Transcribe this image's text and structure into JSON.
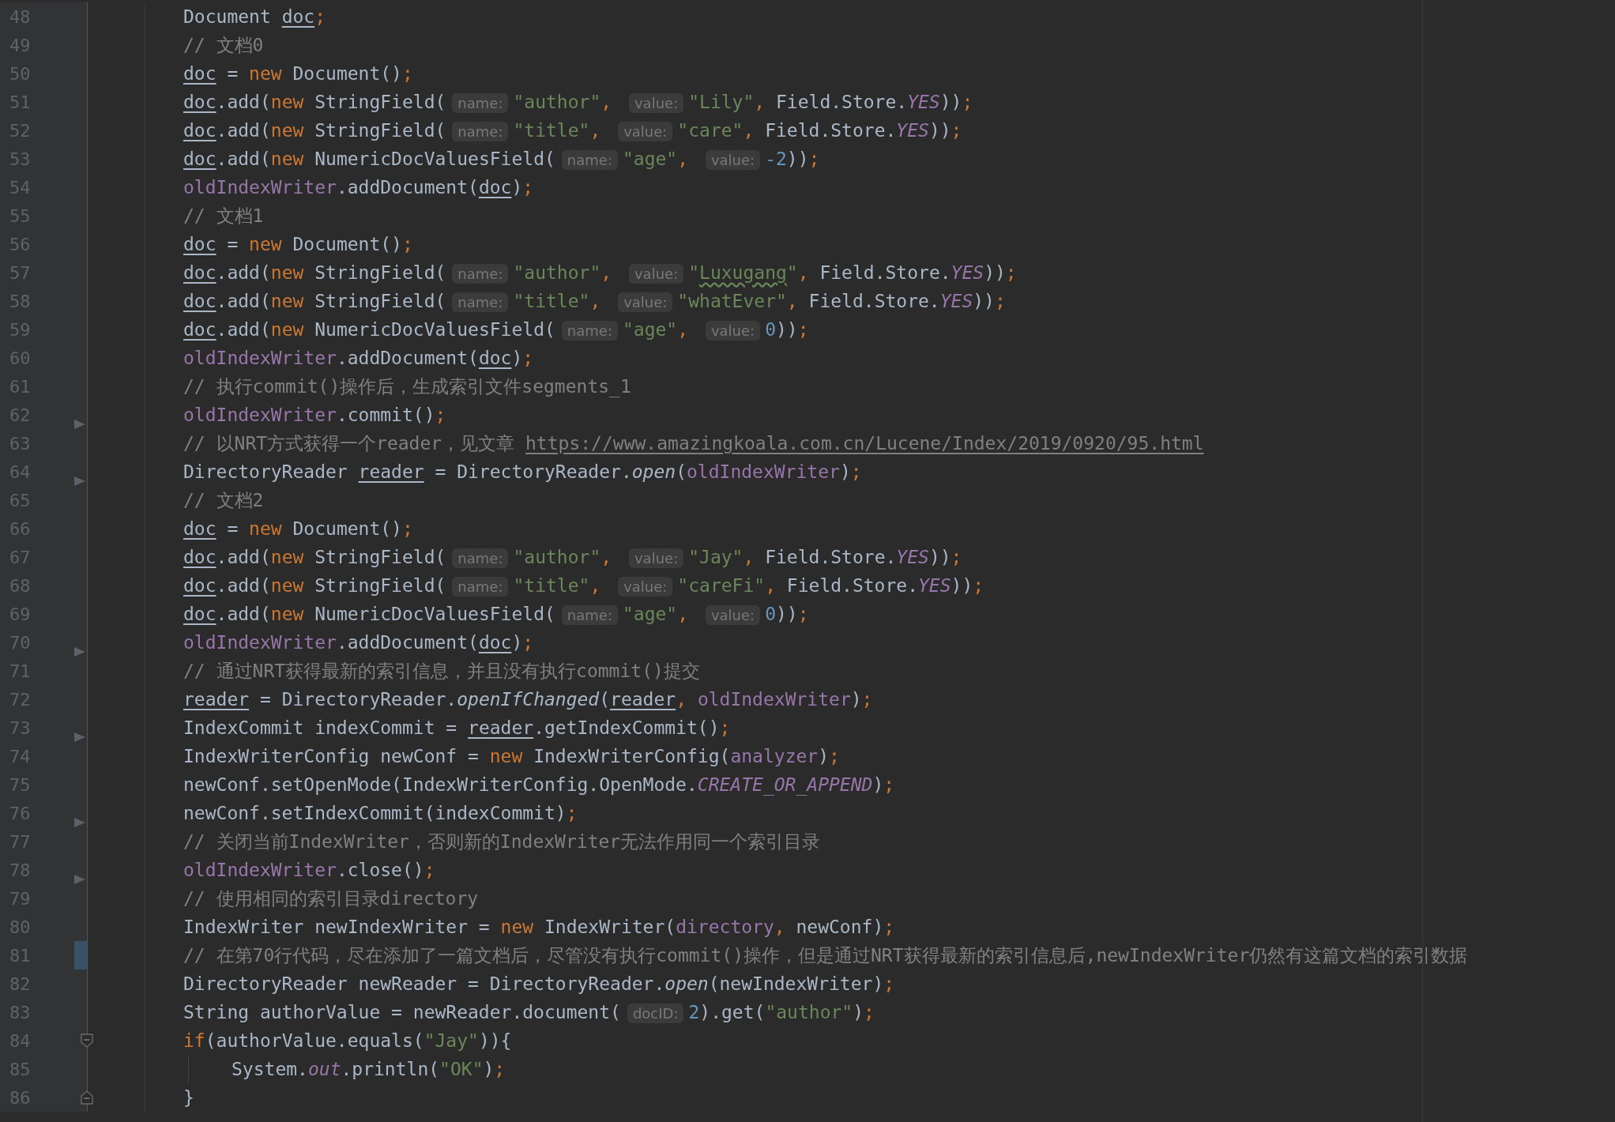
{
  "editor": {
    "lines": [
      {
        "number": "48",
        "tokens": [
          {
            "text": "Document ",
            "kind": "p"
          },
          {
            "text": "doc",
            "kind": "var"
          },
          {
            "text": ";",
            "kind": "o"
          }
        ]
      },
      {
        "number": "49",
        "tokens": [
          {
            "text": "// 文档0",
            "kind": "c"
          }
        ]
      },
      {
        "number": "50",
        "tokens": [
          {
            "text": "doc",
            "kind": "var"
          },
          {
            "text": " = ",
            "kind": "p"
          },
          {
            "text": "new",
            "kind": "k"
          },
          {
            "text": " Document()",
            "kind": "p"
          },
          {
            "text": ";",
            "kind": "o"
          }
        ]
      },
      {
        "number": "51",
        "tokens": [
          {
            "text": "doc",
            "kind": "var"
          },
          {
            "text": ".add(",
            "kind": "p"
          },
          {
            "text": "new",
            "kind": "k"
          },
          {
            "text": " StringField(",
            "kind": "p"
          },
          {
            "text": "name:",
            "kind": "hint"
          },
          {
            "text": "\"author\"",
            "kind": "s"
          },
          {
            "text": ", ",
            "kind": "o"
          },
          {
            "text": "value:",
            "kind": "hint"
          },
          {
            "text": "\"Lily\"",
            "kind": "s"
          },
          {
            "text": ", ",
            "kind": "o"
          },
          {
            "text": "Field.Store.",
            "kind": "p"
          },
          {
            "text": "YES",
            "kind": "st"
          },
          {
            "text": "))",
            "kind": "p"
          },
          {
            "text": ";",
            "kind": "o"
          }
        ]
      },
      {
        "number": "52",
        "tokens": [
          {
            "text": "doc",
            "kind": "var"
          },
          {
            "text": ".add(",
            "kind": "p"
          },
          {
            "text": "new",
            "kind": "k"
          },
          {
            "text": " StringField(",
            "kind": "p"
          },
          {
            "text": "name:",
            "kind": "hint"
          },
          {
            "text": "\"title\"",
            "kind": "s"
          },
          {
            "text": ", ",
            "kind": "o"
          },
          {
            "text": "value:",
            "kind": "hint"
          },
          {
            "text": "\"care\"",
            "kind": "s"
          },
          {
            "text": ", ",
            "kind": "o"
          },
          {
            "text": "Field.Store.",
            "kind": "p"
          },
          {
            "text": "YES",
            "kind": "st"
          },
          {
            "text": "))",
            "kind": "p"
          },
          {
            "text": ";",
            "kind": "o"
          }
        ]
      },
      {
        "number": "53",
        "tokens": [
          {
            "text": "doc",
            "kind": "var"
          },
          {
            "text": ".add(",
            "kind": "p"
          },
          {
            "text": "new",
            "kind": "k"
          },
          {
            "text": " NumericDocValuesField(",
            "kind": "p"
          },
          {
            "text": "name:",
            "kind": "hint"
          },
          {
            "text": "\"age\"",
            "kind": "s"
          },
          {
            "text": ", ",
            "kind": "o"
          },
          {
            "text": "value:",
            "kind": "hint"
          },
          {
            "text": "-2",
            "kind": "n"
          },
          {
            "text": "))",
            "kind": "p"
          },
          {
            "text": ";",
            "kind": "o"
          }
        ]
      },
      {
        "number": "54",
        "tokens": [
          {
            "text": "oldIndexWriter",
            "kind": "f"
          },
          {
            "text": ".addDocument(",
            "kind": "p"
          },
          {
            "text": "doc",
            "kind": "var"
          },
          {
            "text": ")",
            "kind": "p"
          },
          {
            "text": ";",
            "kind": "o"
          }
        ]
      },
      {
        "number": "55",
        "tokens": [
          {
            "text": "// 文档1",
            "kind": "c"
          }
        ]
      },
      {
        "number": "56",
        "tokens": [
          {
            "text": "doc",
            "kind": "var"
          },
          {
            "text": " = ",
            "kind": "p"
          },
          {
            "text": "new",
            "kind": "k"
          },
          {
            "text": " Document()",
            "kind": "p"
          },
          {
            "text": ";",
            "kind": "o"
          }
        ]
      },
      {
        "number": "57",
        "tokens": [
          {
            "text": "doc",
            "kind": "var"
          },
          {
            "text": ".add(",
            "kind": "p"
          },
          {
            "text": "new",
            "kind": "k"
          },
          {
            "text": " StringField(",
            "kind": "p"
          },
          {
            "text": "name:",
            "kind": "hint"
          },
          {
            "text": "\"author\"",
            "kind": "s"
          },
          {
            "text": ", ",
            "kind": "o"
          },
          {
            "text": "value:",
            "kind": "hint"
          },
          {
            "text": "\"",
            "kind": "s"
          },
          {
            "text": "Luxugang",
            "kind": "typo"
          },
          {
            "text": "\"",
            "kind": "s"
          },
          {
            "text": ", ",
            "kind": "o"
          },
          {
            "text": "Field.Store.",
            "kind": "p"
          },
          {
            "text": "YES",
            "kind": "st"
          },
          {
            "text": "))",
            "kind": "p"
          },
          {
            "text": ";",
            "kind": "o"
          }
        ]
      },
      {
        "number": "58",
        "tokens": [
          {
            "text": "doc",
            "kind": "var"
          },
          {
            "text": ".add(",
            "kind": "p"
          },
          {
            "text": "new",
            "kind": "k"
          },
          {
            "text": " StringField(",
            "kind": "p"
          },
          {
            "text": "name:",
            "kind": "hint"
          },
          {
            "text": "\"title\"",
            "kind": "s"
          },
          {
            "text": ", ",
            "kind": "o"
          },
          {
            "text": "value:",
            "kind": "hint"
          },
          {
            "text": "\"whatEver\"",
            "kind": "s"
          },
          {
            "text": ", ",
            "kind": "o"
          },
          {
            "text": "Field.Store.",
            "kind": "p"
          },
          {
            "text": "YES",
            "kind": "st"
          },
          {
            "text": "))",
            "kind": "p"
          },
          {
            "text": ";",
            "kind": "o"
          }
        ]
      },
      {
        "number": "59",
        "tokens": [
          {
            "text": "doc",
            "kind": "var"
          },
          {
            "text": ".add(",
            "kind": "p"
          },
          {
            "text": "new",
            "kind": "k"
          },
          {
            "text": " NumericDocValuesField(",
            "kind": "p"
          },
          {
            "text": "name:",
            "kind": "hint"
          },
          {
            "text": "\"age\"",
            "kind": "s"
          },
          {
            "text": ", ",
            "kind": "o"
          },
          {
            "text": "value:",
            "kind": "hint"
          },
          {
            "text": "0",
            "kind": "n"
          },
          {
            "text": "))",
            "kind": "p"
          },
          {
            "text": ";",
            "kind": "o"
          }
        ]
      },
      {
        "number": "60",
        "tokens": [
          {
            "text": "oldIndexWriter",
            "kind": "f"
          },
          {
            "text": ".addDocument(",
            "kind": "p"
          },
          {
            "text": "doc",
            "kind": "var"
          },
          {
            "text": ")",
            "kind": "p"
          },
          {
            "text": ";",
            "kind": "o"
          }
        ]
      },
      {
        "number": "61",
        "tokens": [
          {
            "text": "// 执行commit()操作后，生成索引文件segments_1",
            "kind": "c"
          }
        ]
      },
      {
        "number": "62",
        "marker": {
          "kind": "arrow"
        },
        "tokens": [
          {
            "text": "oldIndexWriter",
            "kind": "f"
          },
          {
            "text": ".commit()",
            "kind": "p"
          },
          {
            "text": ";",
            "kind": "o"
          }
        ]
      },
      {
        "number": "63",
        "tokens": [
          {
            "text": "// 以NRT方式获得一个reader，见文章 ",
            "kind": "c"
          },
          {
            "text": "https://www.amazingkoala.com.cn/Lucene/Index/2019/0920/95.html",
            "kind": "link"
          }
        ]
      },
      {
        "number": "64",
        "marker": {
          "kind": "arrow"
        },
        "tokens": [
          {
            "text": "DirectoryReader ",
            "kind": "p"
          },
          {
            "text": "reader",
            "kind": "var"
          },
          {
            "text": " = DirectoryReader.",
            "kind": "p"
          },
          {
            "text": "open",
            "kind": "it"
          },
          {
            "text": "(",
            "kind": "p"
          },
          {
            "text": "oldIndexWriter",
            "kind": "f"
          },
          {
            "text": ")",
            "kind": "p"
          },
          {
            "text": ";",
            "kind": "o"
          }
        ]
      },
      {
        "number": "65",
        "tokens": [
          {
            "text": "// 文档2",
            "kind": "c"
          }
        ]
      },
      {
        "number": "66",
        "tokens": [
          {
            "text": "doc",
            "kind": "var"
          },
          {
            "text": " = ",
            "kind": "p"
          },
          {
            "text": "new",
            "kind": "k"
          },
          {
            "text": " Document()",
            "kind": "p"
          },
          {
            "text": ";",
            "kind": "o"
          }
        ]
      },
      {
        "number": "67",
        "tokens": [
          {
            "text": "doc",
            "kind": "var"
          },
          {
            "text": ".add(",
            "kind": "p"
          },
          {
            "text": "new",
            "kind": "k"
          },
          {
            "text": " StringField(",
            "kind": "p"
          },
          {
            "text": "name:",
            "kind": "hint"
          },
          {
            "text": "\"author\"",
            "kind": "s"
          },
          {
            "text": ", ",
            "kind": "o"
          },
          {
            "text": "value:",
            "kind": "hint"
          },
          {
            "text": "\"Jay\"",
            "kind": "s"
          },
          {
            "text": ", ",
            "kind": "o"
          },
          {
            "text": "Field.Store.",
            "kind": "p"
          },
          {
            "text": "YES",
            "kind": "st"
          },
          {
            "text": "))",
            "kind": "p"
          },
          {
            "text": ";",
            "kind": "o"
          }
        ]
      },
      {
        "number": "68",
        "tokens": [
          {
            "text": "doc",
            "kind": "var"
          },
          {
            "text": ".add(",
            "kind": "p"
          },
          {
            "text": "new",
            "kind": "k"
          },
          {
            "text": " StringField(",
            "kind": "p"
          },
          {
            "text": "name:",
            "kind": "hint"
          },
          {
            "text": "\"title\"",
            "kind": "s"
          },
          {
            "text": ", ",
            "kind": "o"
          },
          {
            "text": "value:",
            "kind": "hint"
          },
          {
            "text": "\"careFi\"",
            "kind": "s"
          },
          {
            "text": ", ",
            "kind": "o"
          },
          {
            "text": "Field.Store.",
            "kind": "p"
          },
          {
            "text": "YES",
            "kind": "st"
          },
          {
            "text": "))",
            "kind": "p"
          },
          {
            "text": ";",
            "kind": "o"
          }
        ]
      },
      {
        "number": "69",
        "tokens": [
          {
            "text": "doc",
            "kind": "var"
          },
          {
            "text": ".add(",
            "kind": "p"
          },
          {
            "text": "new",
            "kind": "k"
          },
          {
            "text": " NumericDocValuesField(",
            "kind": "p"
          },
          {
            "text": "name:",
            "kind": "hint"
          },
          {
            "text": "\"age\"",
            "kind": "s"
          },
          {
            "text": ", ",
            "kind": "o"
          },
          {
            "text": "value:",
            "kind": "hint"
          },
          {
            "text": "0",
            "kind": "n"
          },
          {
            "text": "))",
            "kind": "p"
          },
          {
            "text": ";",
            "kind": "o"
          }
        ]
      },
      {
        "number": "70",
        "marker": {
          "kind": "arrow"
        },
        "tokens": [
          {
            "text": "oldIndexWriter",
            "kind": "f"
          },
          {
            "text": ".addDocument(",
            "kind": "p"
          },
          {
            "text": "doc",
            "kind": "var"
          },
          {
            "text": ")",
            "kind": "p"
          },
          {
            "text": ";",
            "kind": "o"
          }
        ]
      },
      {
        "number": "71",
        "tokens": [
          {
            "text": "// 通过NRT获得最新的索引信息，并且没有执行commit()提交",
            "kind": "c"
          }
        ]
      },
      {
        "number": "72",
        "tokens": [
          {
            "text": "reader",
            "kind": "var"
          },
          {
            "text": " = DirectoryReader.",
            "kind": "p"
          },
          {
            "text": "openIfChanged",
            "kind": "it"
          },
          {
            "text": "(",
            "kind": "p"
          },
          {
            "text": "reader",
            "kind": "var"
          },
          {
            "text": ", ",
            "kind": "o"
          },
          {
            "text": "oldIndexWriter",
            "kind": "f"
          },
          {
            "text": ")",
            "kind": "p"
          },
          {
            "text": ";",
            "kind": "o"
          }
        ]
      },
      {
        "number": "73",
        "marker": {
          "kind": "arrow"
        },
        "tokens": [
          {
            "text": "IndexCommit indexCommit = ",
            "kind": "p"
          },
          {
            "text": "reader",
            "kind": "var"
          },
          {
            "text": ".getIndexCommit()",
            "kind": "p"
          },
          {
            "text": ";",
            "kind": "o"
          }
        ]
      },
      {
        "number": "74",
        "tokens": [
          {
            "text": "IndexWriterConfig newConf = ",
            "kind": "p"
          },
          {
            "text": "new",
            "kind": "k"
          },
          {
            "text": " IndexWriterConfig(",
            "kind": "p"
          },
          {
            "text": "analyzer",
            "kind": "f"
          },
          {
            "text": ")",
            "kind": "p"
          },
          {
            "text": ";",
            "kind": "o"
          }
        ]
      },
      {
        "number": "75",
        "tokens": [
          {
            "text": "newConf.setOpenMode(IndexWriterConfig.OpenMode.",
            "kind": "p"
          },
          {
            "text": "CREATE_OR_APPEND",
            "kind": "st"
          },
          {
            "text": ")",
            "kind": "p"
          },
          {
            "text": ";",
            "kind": "o"
          }
        ]
      },
      {
        "number": "76",
        "marker": {
          "kind": "arrow"
        },
        "tokens": [
          {
            "text": "newConf.setIndexCommit(indexCommit)",
            "kind": "p"
          },
          {
            "text": ";",
            "kind": "o"
          }
        ]
      },
      {
        "number": "77",
        "tokens": [
          {
            "text": "// 关闭当前IndexWriter，否则新的IndexWriter无法作用同一个索引目录",
            "kind": "c"
          }
        ]
      },
      {
        "number": "78",
        "marker": {
          "kind": "arrow"
        },
        "tokens": [
          {
            "text": "oldIndexWriter",
            "kind": "f"
          },
          {
            "text": ".close()",
            "kind": "p"
          },
          {
            "text": ";",
            "kind": "o"
          }
        ]
      },
      {
        "number": "79",
        "tokens": [
          {
            "text": "// 使用相同的索引目录directory",
            "kind": "c"
          }
        ]
      },
      {
        "number": "80",
        "tokens": [
          {
            "text": "IndexWriter newIndexWriter = ",
            "kind": "p"
          },
          {
            "text": "new",
            "kind": "k"
          },
          {
            "text": " IndexWriter(",
            "kind": "p"
          },
          {
            "text": "directory",
            "kind": "f"
          },
          {
            "text": ", ",
            "kind": "o"
          },
          {
            "text": "newConf)",
            "kind": "p"
          },
          {
            "text": ";",
            "kind": "o"
          }
        ]
      },
      {
        "number": "81",
        "marker": {
          "kind": "change"
        },
        "tokens": [
          {
            "text": "// 在第70行代码，尽在添加了一篇文档后，尽管没有执行commit()操作，但是通过NRT获得最新的索引信息后,newIndexWriter仍然有这篇文档的索引数据",
            "kind": "c"
          }
        ]
      },
      {
        "number": "82",
        "tokens": [
          {
            "text": "DirectoryReader newReader = DirectoryReader.",
            "kind": "p"
          },
          {
            "text": "open",
            "kind": "it"
          },
          {
            "text": "(newIndexWriter)",
            "kind": "p"
          },
          {
            "text": ";",
            "kind": "o"
          }
        ]
      },
      {
        "number": "83",
        "tokens": [
          {
            "text": "String authorValue = newReader.document(",
            "kind": "p"
          },
          {
            "text": "docID:",
            "kind": "hint"
          },
          {
            "text": "2",
            "kind": "n"
          },
          {
            "text": ").get(",
            "kind": "p"
          },
          {
            "text": "\"author\"",
            "kind": "s"
          },
          {
            "text": ")",
            "kind": "p"
          },
          {
            "text": ";",
            "kind": "o"
          }
        ]
      },
      {
        "number": "84",
        "marker": {
          "kind": "fold_start"
        },
        "tokens": [
          {
            "text": "if",
            "kind": "k"
          },
          {
            "text": "(authorValue.equals(",
            "kind": "p"
          },
          {
            "text": "\"Jay\"",
            "kind": "s"
          },
          {
            "text": ")){",
            "kind": "p"
          }
        ]
      },
      {
        "number": "85",
        "guide": true,
        "tokens": [
          {
            "text": "System.",
            "kind": "p"
          },
          {
            "text": "out",
            "kind": "st"
          },
          {
            "text": ".println(",
            "kind": "p"
          },
          {
            "text": "\"OK\"",
            "kind": "s"
          },
          {
            "text": ")",
            "kind": "p"
          },
          {
            "text": ";",
            "kind": "o"
          }
        ]
      },
      {
        "number": "86",
        "marker": {
          "kind": "fold_end"
        },
        "tokens": [
          {
            "text": "}",
            "kind": "p"
          }
        ]
      }
    ]
  }
}
